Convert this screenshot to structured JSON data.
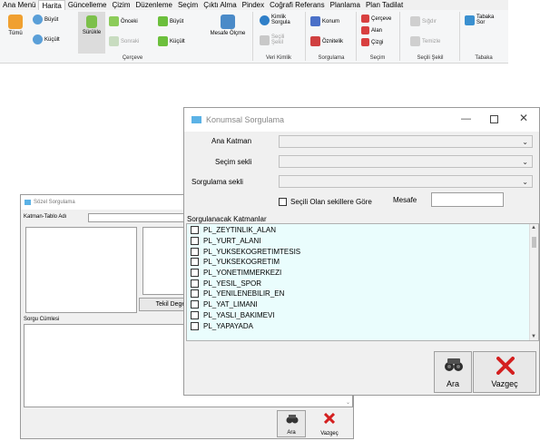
{
  "ribbon": {
    "tabs": [
      "Ana Menü",
      "Harita",
      "Güncelleme",
      "Çizim",
      "Düzenleme",
      "Seçim",
      "Çıktı Alma",
      "Pindex",
      "Coğrafi Referans",
      "Planlama",
      "Plan Tadilat"
    ],
    "active_tab": "Harita",
    "buttons": {
      "tumu": "Tümü",
      "buyut": "Büyüt",
      "kucult": "Küçült",
      "surukle": "Sürükle",
      "onceki": "Önceki",
      "sonraki": "Sonraki",
      "buyut2": "Büyüt",
      "kucult2": "Küçült",
      "mesafe_olcme": "Mesafe Ölçme",
      "kimlik_sorgula": "Kimlik Sorgula",
      "secili_sekil": "Seçili Şekil",
      "konum": "Konum",
      "oznitelik": "Öznitelik",
      "cerceve": "Çerçeve",
      "alan": "Alan",
      "cizgi": "Çizgi",
      "sigdir": "Sığdır",
      "temizle": "Temizle",
      "tabaka_sor": "Tabaka Sor"
    },
    "groups": {
      "cerceve": "Çerçeve",
      "veri_kimlik": "Veri Kimlik",
      "sorgulama": "Sorgulama",
      "secim": "Seçim",
      "secili_sekil": "Seçili Şekil",
      "tabaka": "Tabaka"
    }
  },
  "back_window": {
    "title": "Sözel Sorgulama",
    "katman_label": "Katman-Tablo Adı",
    "tekil_button": "Tekil Dege",
    "sorgu_label": "Sorgu Cümlesi",
    "ara": "Ara",
    "vazgec": "Vazgeç"
  },
  "front_window": {
    "title": "Konumsal Sorgulama",
    "ana_katman_label": "Ana Katman",
    "secim_sekli_label": "Seçim sekli",
    "sorgulama_sekli_label": "Sorgulama sekli",
    "ana_katman_value": "",
    "secim_sekli_value": "",
    "sorgulama_sekli_value": "",
    "secili_checkbox": "Seçili Olan sekillere Göre",
    "mesafe_label": "Mesafe",
    "mesafe_value": "",
    "list_label": "Sorgulanacak Katmanlar",
    "layers": [
      "PL_ZEYTINLIK_ALAN",
      "PL_YURT_ALANI",
      "PL_YUKSEKOGRETIMTESIS",
      "PL_YUKSEKOGRETIM",
      "PL_YONETIMMERKEZI",
      "PL_YESIL_SPOR",
      "PL_YENILENEBILIR_EN",
      "PL_YAT_LIMANI",
      "PL_YASLI_BAKIMEVI",
      "PL_YAPAYADA"
    ],
    "ara": "Ara",
    "vazgec": "Vazgeç"
  },
  "colors": {
    "list_bg": "#eafdfd",
    "title_icon": "#5bb2e6",
    "cancel_x": "#d42020"
  }
}
